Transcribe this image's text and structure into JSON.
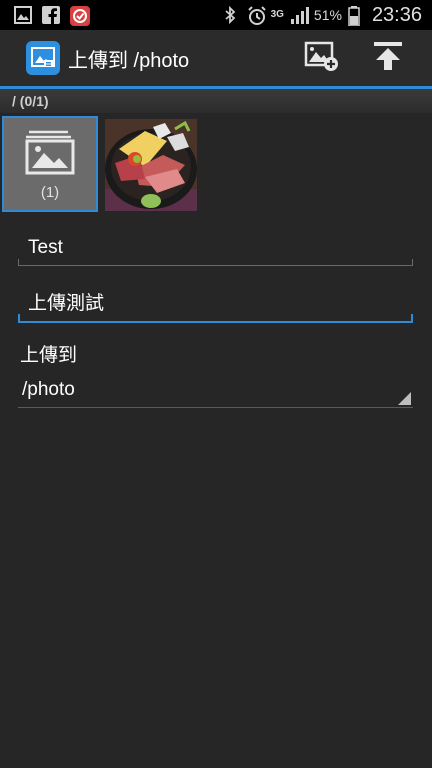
{
  "status_bar": {
    "battery_percent": "51%",
    "network": "3G",
    "time": "23:36",
    "icons": [
      "gallery-icon",
      "facebook-icon",
      "app-notification-icon",
      "bluetooth-icon",
      "alarm-icon",
      "signal-icon",
      "battery-icon"
    ]
  },
  "action_bar": {
    "title": "上傳到 /photo",
    "actions": [
      "add-photo-icon",
      "upload-icon"
    ],
    "accent_color": "#2f8ad8"
  },
  "path_header": {
    "label": "/ (0/1)"
  },
  "thumbnails": {
    "album_count": "(1)"
  },
  "form": {
    "title_value": "Test",
    "description_value": "上傳測試",
    "upload_to_label": "上傳到",
    "upload_to_selected": "/photo"
  }
}
